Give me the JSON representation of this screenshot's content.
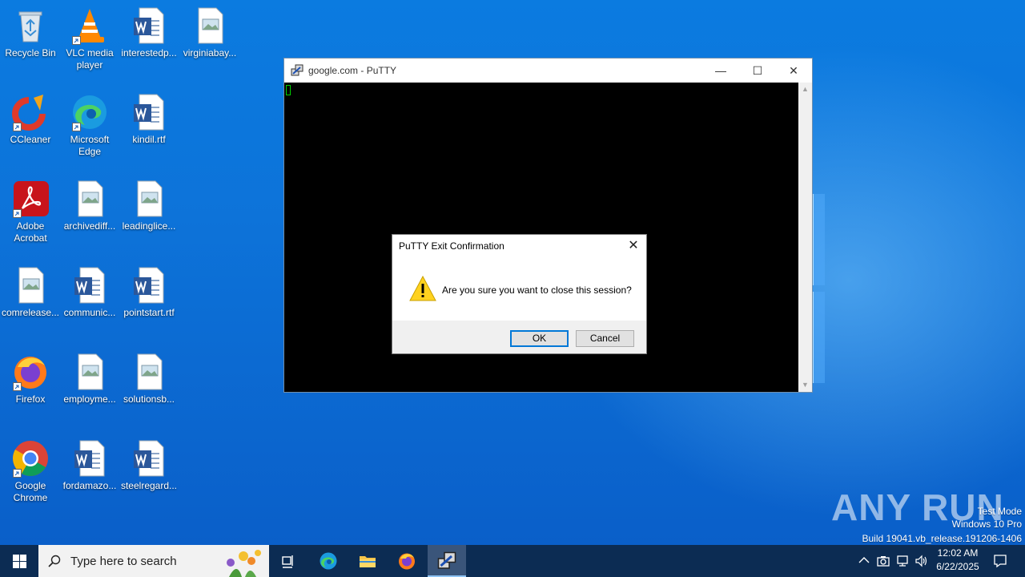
{
  "desktop": {
    "icons": [
      {
        "label": "Recycle Bin",
        "icon": "recycle-bin-icon"
      },
      {
        "label": "VLC media player",
        "icon": "vlc-icon"
      },
      {
        "label": "interestedp...",
        "icon": "word-doc-icon"
      },
      {
        "label": "virginiabay...",
        "icon": "image-file-icon"
      },
      {
        "label": "CCleaner",
        "icon": "ccleaner-icon"
      },
      {
        "label": "Microsoft Edge",
        "icon": "edge-icon"
      },
      {
        "label": "kindil.rtf",
        "icon": "word-doc-icon"
      },
      {
        "label": "Adobe Acrobat",
        "icon": "acrobat-icon"
      },
      {
        "label": "archivediff...",
        "icon": "image-file-icon"
      },
      {
        "label": "leadinglice...",
        "icon": "image-file-icon"
      },
      {
        "label": "comrelease...",
        "icon": "image-file-icon"
      },
      {
        "label": "communic...",
        "icon": "word-doc-icon"
      },
      {
        "label": "pointstart.rtf",
        "icon": "word-doc-icon"
      },
      {
        "label": "Firefox",
        "icon": "firefox-icon"
      },
      {
        "label": "employme...",
        "icon": "image-file-icon"
      },
      {
        "label": "solutionsb...",
        "icon": "image-file-icon"
      },
      {
        "label": "Google Chrome",
        "icon": "chrome-icon"
      },
      {
        "label": "fordamazo...",
        "icon": "word-doc-icon"
      },
      {
        "label": "steelregard...",
        "icon": "word-doc-icon"
      }
    ]
  },
  "putty_window": {
    "title": "google.com - PuTTY",
    "minimize": "—",
    "maximize": "☐",
    "close": "✕"
  },
  "dialog": {
    "title": "PuTTY Exit Confirmation",
    "close": "✕",
    "message": "Are you sure you want to close this session?",
    "ok_label": "OK",
    "cancel_label": "Cancel"
  },
  "watermark": {
    "brand": "ANY RUN",
    "test_mode": "Test Mode",
    "edition": "Windows 10 Pro",
    "build": "Build 19041.vb_release.191206-1406"
  },
  "taskbar": {
    "search_placeholder": "Type here to search",
    "time": "12:02 AM",
    "date": "6/22/2025"
  }
}
